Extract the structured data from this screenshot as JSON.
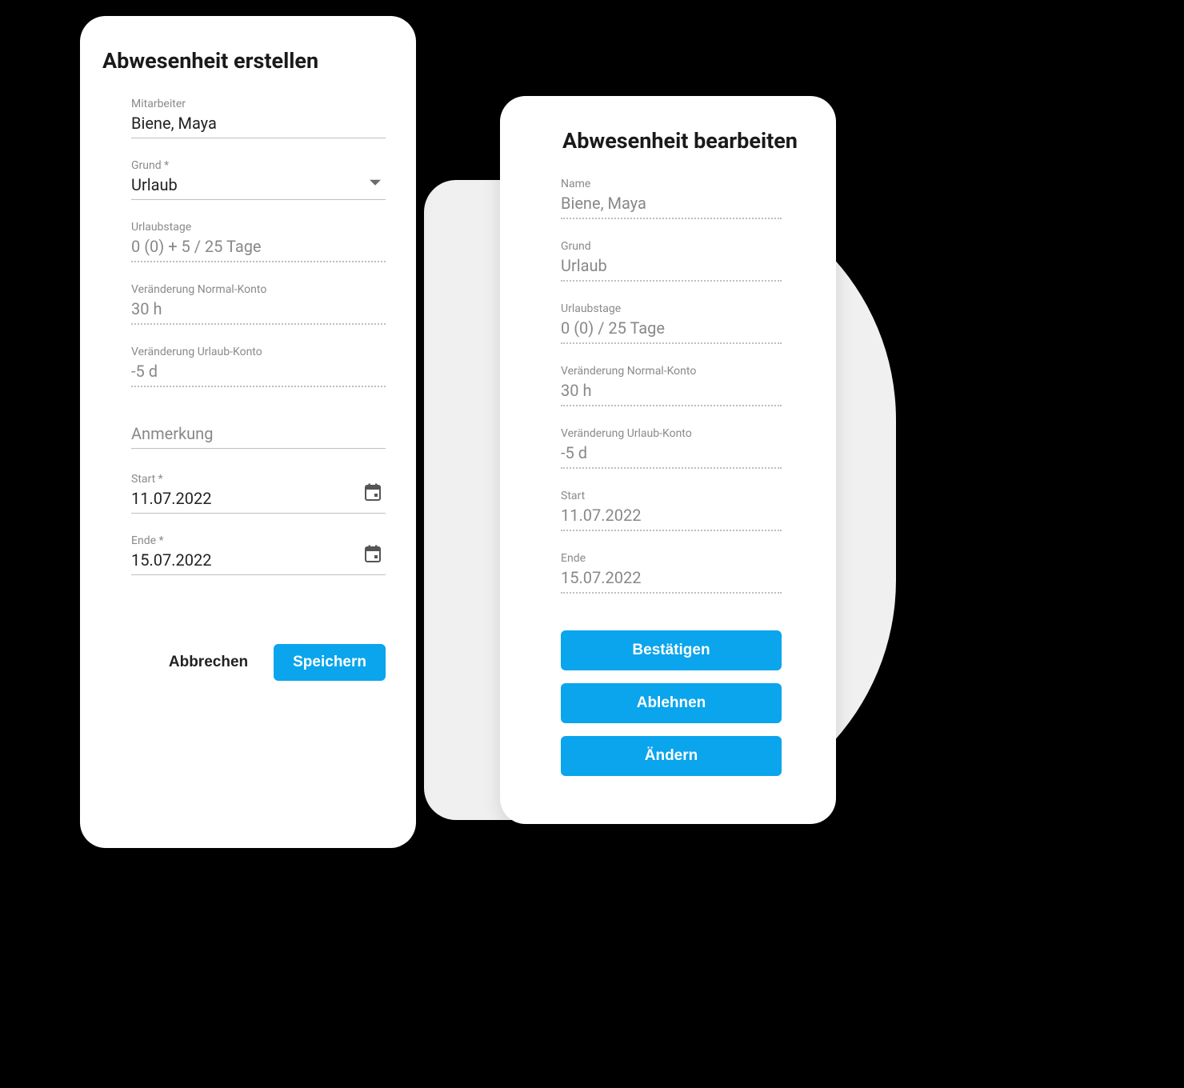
{
  "colors": {
    "accent": "#0aa5ec"
  },
  "create": {
    "title": "Abwesenheit erstellen",
    "employee": {
      "label": "Mitarbeiter",
      "value": "Biene, Maya"
    },
    "reason": {
      "label": "Grund *",
      "value": "Urlaub"
    },
    "vacationDays": {
      "label": "Urlaubstage",
      "value": "0 (0)  + 5 / 25 Tage"
    },
    "normalAccount": {
      "label": "Veränderung Normal-Konto",
      "value": "30 h"
    },
    "vacationAccount": {
      "label": "Veränderung Urlaub-Konto",
      "value": "-5 d"
    },
    "note": {
      "placeholder": "Anmerkung"
    },
    "start": {
      "label": "Start *",
      "value": "11.07.2022"
    },
    "end": {
      "label": "Ende *",
      "value": "15.07.2022"
    },
    "buttons": {
      "cancel": "Abbrechen",
      "save": "Speichern"
    }
  },
  "edit": {
    "title": "Abwesenheit bearbeiten",
    "name": {
      "label": "Name",
      "value": "Biene, Maya"
    },
    "reason": {
      "label": "Grund",
      "value": "Urlaub"
    },
    "vacationDays": {
      "label": "Urlaubstage",
      "value": "0 (0)  / 25 Tage"
    },
    "normalAccount": {
      "label": "Veränderung Normal-Konto",
      "value": "30 h"
    },
    "vacationAccount": {
      "label": "Veränderung Urlaub-Konto",
      "value": "-5 d"
    },
    "start": {
      "label": "Start",
      "value": "11.07.2022"
    },
    "end": {
      "label": "Ende",
      "value": "15.07.2022"
    },
    "buttons": {
      "confirm": "Bestätigen",
      "reject": "Ablehnen",
      "change": "Ändern"
    }
  }
}
